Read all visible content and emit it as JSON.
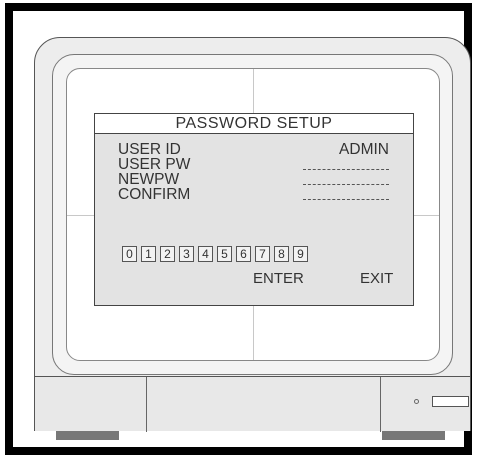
{
  "dialog": {
    "title": "PASSWORD SETUP",
    "fields": [
      {
        "label": "USER ID",
        "value": "ADMIN"
      },
      {
        "label": "USER PW",
        "value": ""
      },
      {
        "label": "NEWPW",
        "value": "________"
      },
      {
        "label": "CONFIRM",
        "value": "________"
      }
    ],
    "keypad": [
      "0",
      "1",
      "2",
      "3",
      "4",
      "5",
      "6",
      "7",
      "8",
      "9"
    ],
    "actions": {
      "enter": "ENTER",
      "exit": "EXIT"
    }
  },
  "icons": {
    "power-button": "power-button-icon",
    "power-indicator": "power-indicator-icon"
  }
}
